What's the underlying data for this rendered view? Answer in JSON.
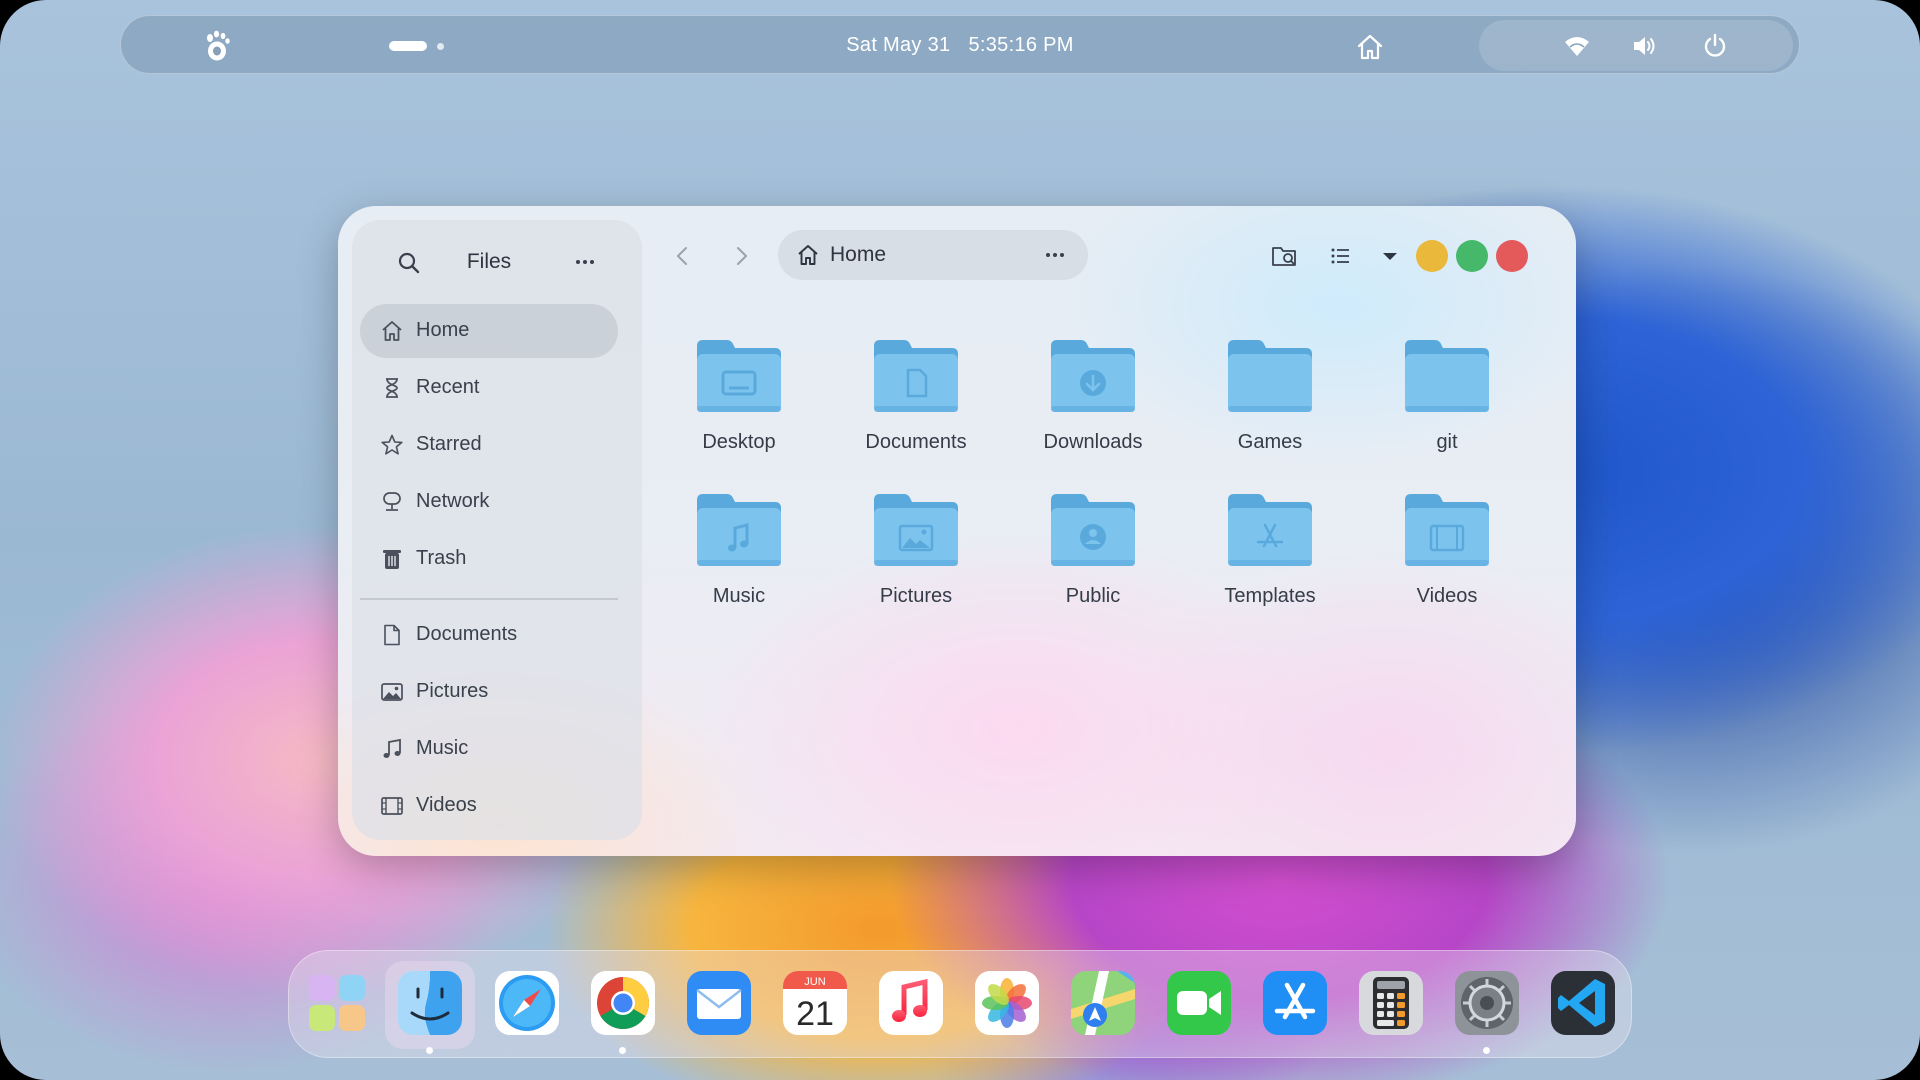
{
  "topbar": {
    "date": "Sat May 31",
    "time": "5:35:16 PM",
    "icons": [
      "gnome-foot-icon",
      "home-icon",
      "wifi-icon",
      "volume-icon",
      "power-icon"
    ]
  },
  "window": {
    "sidebar": {
      "title": "Files",
      "places": [
        {
          "label": "Home",
          "icon": "home-icon",
          "active": true
        },
        {
          "label": "Recent",
          "icon": "hourglass-icon"
        },
        {
          "label": "Starred",
          "icon": "star-icon"
        },
        {
          "label": "Network",
          "icon": "network-icon"
        },
        {
          "label": "Trash",
          "icon": "trash-icon"
        }
      ],
      "bookmarks": [
        {
          "label": "Documents",
          "icon": "document-icon"
        },
        {
          "label": "Pictures",
          "icon": "picture-icon"
        },
        {
          "label": "Music",
          "icon": "music-note-icon"
        },
        {
          "label": "Videos",
          "icon": "film-icon"
        }
      ]
    },
    "pathbar": {
      "label": "Home"
    },
    "folders": [
      {
        "name": "Desktop",
        "glyph": "monitor"
      },
      {
        "name": "Documents",
        "glyph": "document"
      },
      {
        "name": "Downloads",
        "glyph": "download"
      },
      {
        "name": "Games",
        "glyph": "none"
      },
      {
        "name": "git",
        "glyph": "none"
      },
      {
        "name": "Music",
        "glyph": "music"
      },
      {
        "name": "Pictures",
        "glyph": "picture"
      },
      {
        "name": "Public",
        "glyph": "person"
      },
      {
        "name": "Templates",
        "glyph": "app-store"
      },
      {
        "name": "Videos",
        "glyph": "film"
      }
    ],
    "window_controls": {
      "minimize": "#eab83a",
      "maximize": "#46b86a",
      "close": "#e45a5a"
    }
  },
  "dock": {
    "calendar_month": "JUN",
    "calendar_day": "21",
    "apps": [
      "launchpad",
      "finder",
      "safari",
      "chrome",
      "mail",
      "calendar",
      "music",
      "photos",
      "maps",
      "facetime",
      "app-store",
      "calculator",
      "system-settings",
      "vscode"
    ],
    "running": [
      "finder",
      "chrome",
      "system-settings"
    ]
  },
  "colors": {
    "folder": "#7cc3ee",
    "folder_dark": "#5aa9dc",
    "accent": "#3584e4"
  }
}
